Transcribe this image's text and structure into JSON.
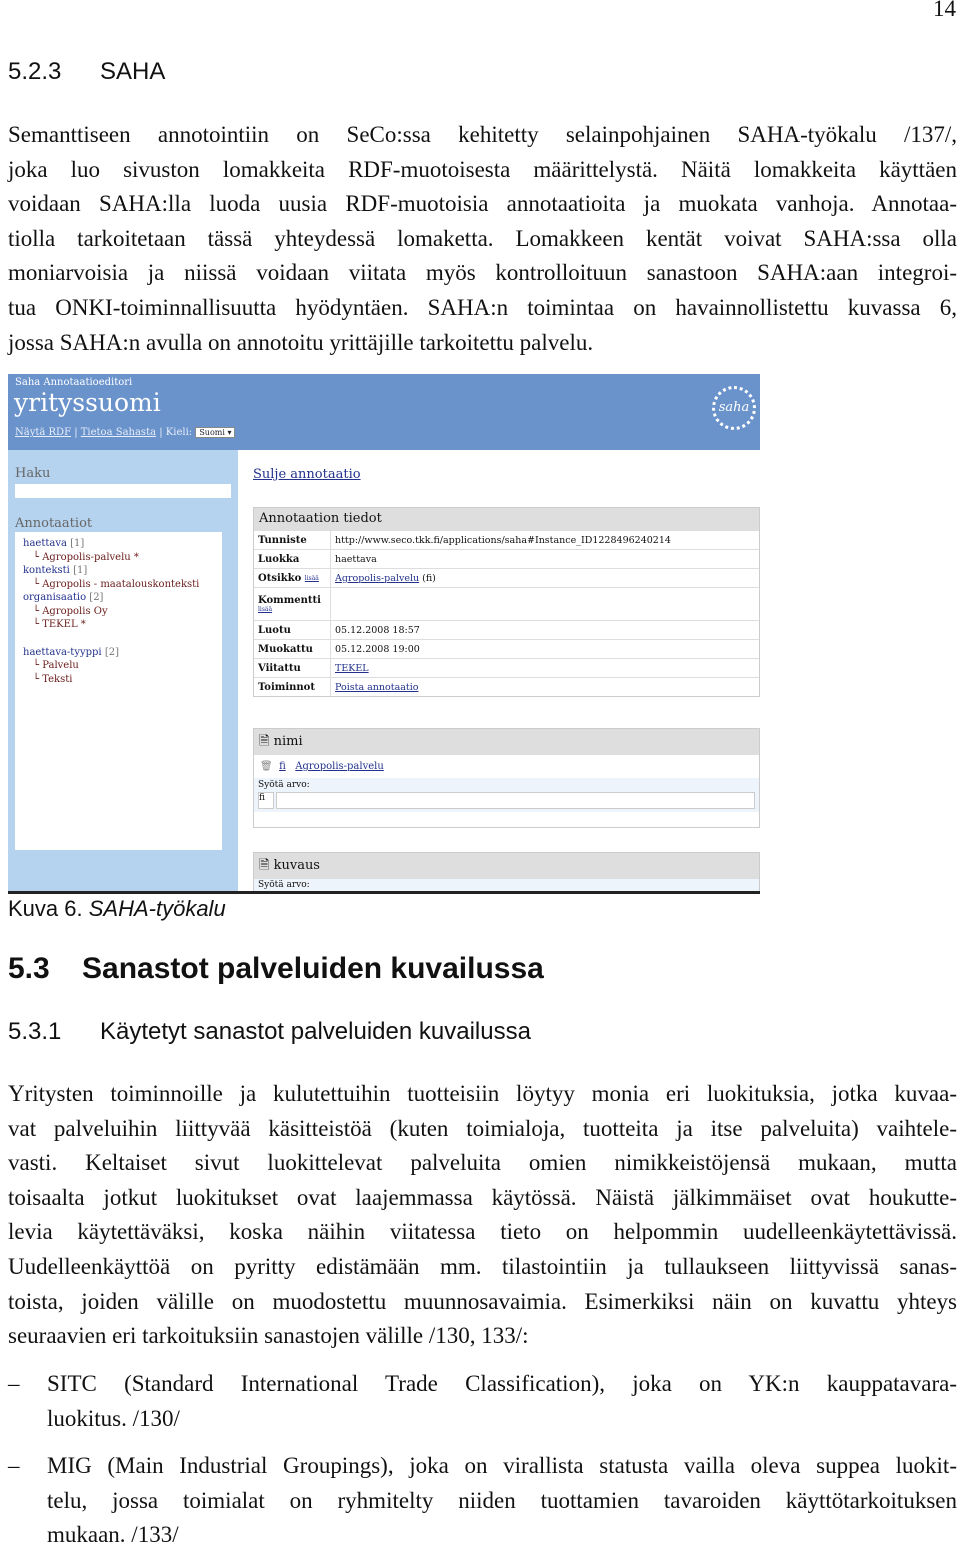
{
  "page_number": "14",
  "section_523": {
    "number": "5.2.3",
    "title": "SAHA"
  },
  "para1": [
    "Semanttiseen annotointiin on SeCo:ssa kehitetty selainpohjainen SAHA-työkalu /137/,",
    "joka luo sivuston lomakkeita RDF-muotoisesta määrittelystä. Näitä lomakkeita käyttäen",
    "voidaan SAHA:lla luoda uusia RDF-muotoisia annotaatioita ja muokata vanhoja. Annotaa-",
    "tiolla tarkoitetaan tässä yhteydessä lomaketta. Lomakkeen kentät voivat SAHA:ssa olla",
    "moniarvoisia ja niissä voidaan viitata myös kontrolloituun sanastoon SAHA:aan integroi-",
    "tua ONKI-toiminnallisuutta hyödyntäen. SAHA:n toimintaa on havainnollistettu kuvassa 6,",
    "jossa SAHA:n avulla on annotoitu yrittäjille tarkoitettu palvelu."
  ],
  "screenshot": {
    "app_subtitle": "Saha Annotaatioeditori",
    "app_title": "yrityssuomi",
    "nav": {
      "show_rdf": "Näytä RDF",
      "about": "Tietoa Sahasta",
      "language_label": "Kieli:",
      "language_value": "Suomi"
    },
    "logo_text": "saha",
    "sidebar": {
      "search_label": "Haku",
      "annotations_label": "Annotaatiot",
      "tree": [
        {
          "label": "haettava",
          "count": "[1]",
          "children": [
            "Agropolis-palvelu *"
          ]
        },
        {
          "label": "konteksti",
          "count": "[1]",
          "children": [
            "Agropolis - maatalouskonteksti"
          ]
        },
        {
          "label": "organisaatio",
          "count": "[2]",
          "children": [
            "Agropolis Oy",
            "TEKEL *"
          ]
        },
        {
          "label": "haettava-tyyppi",
          "count": "[2]",
          "children": [
            "Palvelu",
            "Teksti"
          ]
        }
      ]
    },
    "close_link": "Sulje annotaatio",
    "details": {
      "title": "Annotaation tiedot",
      "add_label": "lisää",
      "rows": {
        "tunniste": {
          "k": "Tunniste",
          "v": "http://www.seco.tkk.fi/applications/saha#Instance_ID1228496240214"
        },
        "luokka": {
          "k": "Luokka",
          "v": "haettava"
        },
        "otsikko": {
          "k": "Otsikko",
          "v": "Agropolis-palvelu",
          "lang": "(fi)"
        },
        "kommentti": {
          "k": "Kommentti",
          "v": ""
        },
        "luotu": {
          "k": "Luotu",
          "v": "05.12.2008 18:57"
        },
        "muokattu": {
          "k": "Muokattu",
          "v": "05.12.2008 19:00"
        },
        "viitattu": {
          "k": "Viitattu",
          "v": "TEKEL"
        },
        "toiminnot": {
          "k": "Toiminnot",
          "v": "Poista annotaatio"
        }
      }
    },
    "nimi": {
      "title": "nimi",
      "lang": "fi",
      "value": "Agropolis-palvelu",
      "input_label": "Syötä arvo:",
      "lang_input": "fi"
    },
    "kuvaus": {
      "title": "kuvaus",
      "input_label": "Syötä arvo:"
    }
  },
  "caption": {
    "label": "Kuva 6.",
    "text": "SAHA-työkalu"
  },
  "section_53": {
    "number": "5.3",
    "title": "Sanastot palveluiden kuvailussa"
  },
  "section_531": {
    "number": "5.3.1",
    "title": "Käytetyt sanastot palveluiden kuvailussa"
  },
  "para2": [
    "Yritysten toiminnoille ja kulutettuihin tuotteisiin löytyy monia eri luokituksia, jotka kuvaa-",
    "vat palveluihin liittyvää käsitteistöä (kuten toimialoja, tuotteita ja itse palveluita) vaihtele-",
    "vasti. Keltaiset sivut luokittelevat palveluita omien nimikkeistöjensä mukaan, mutta",
    "toisaalta jotkut luokitukset ovat laajemmassa käytössä. Näistä jälkimmäiset ovat houkutte-",
    "levia käytettäväksi, koska näihin viitatessa tieto on helpommin uudelleenkäytettävissä.",
    "Uudelleenkäyttöä on pyritty edistämään mm. tilastointiin ja tullaukseen liittyvissä sanas-",
    "toista, joiden välille on muodostettu muunnosavaimia. Esimerkiksi näin on kuvattu yhteys",
    "seuraavien eri tarkoituksiin sanastojen välille /130, 133/:"
  ],
  "bullets": [
    {
      "dash": "–",
      "lines": [
        "SITC (Standard International Trade Classification), joka on YK:n kauppatavara-",
        "luokitus. /130/"
      ]
    },
    {
      "dash": "–",
      "lines": [
        "MIG (Main Industrial Groupings), joka on virallista statusta vailla oleva suppea luokit-",
        "telu, jossa toimialat on ryhmitelty niiden tuottamien tavaroiden käyttötarkoituksen",
        "mukaan. /133/"
      ]
    }
  ]
}
